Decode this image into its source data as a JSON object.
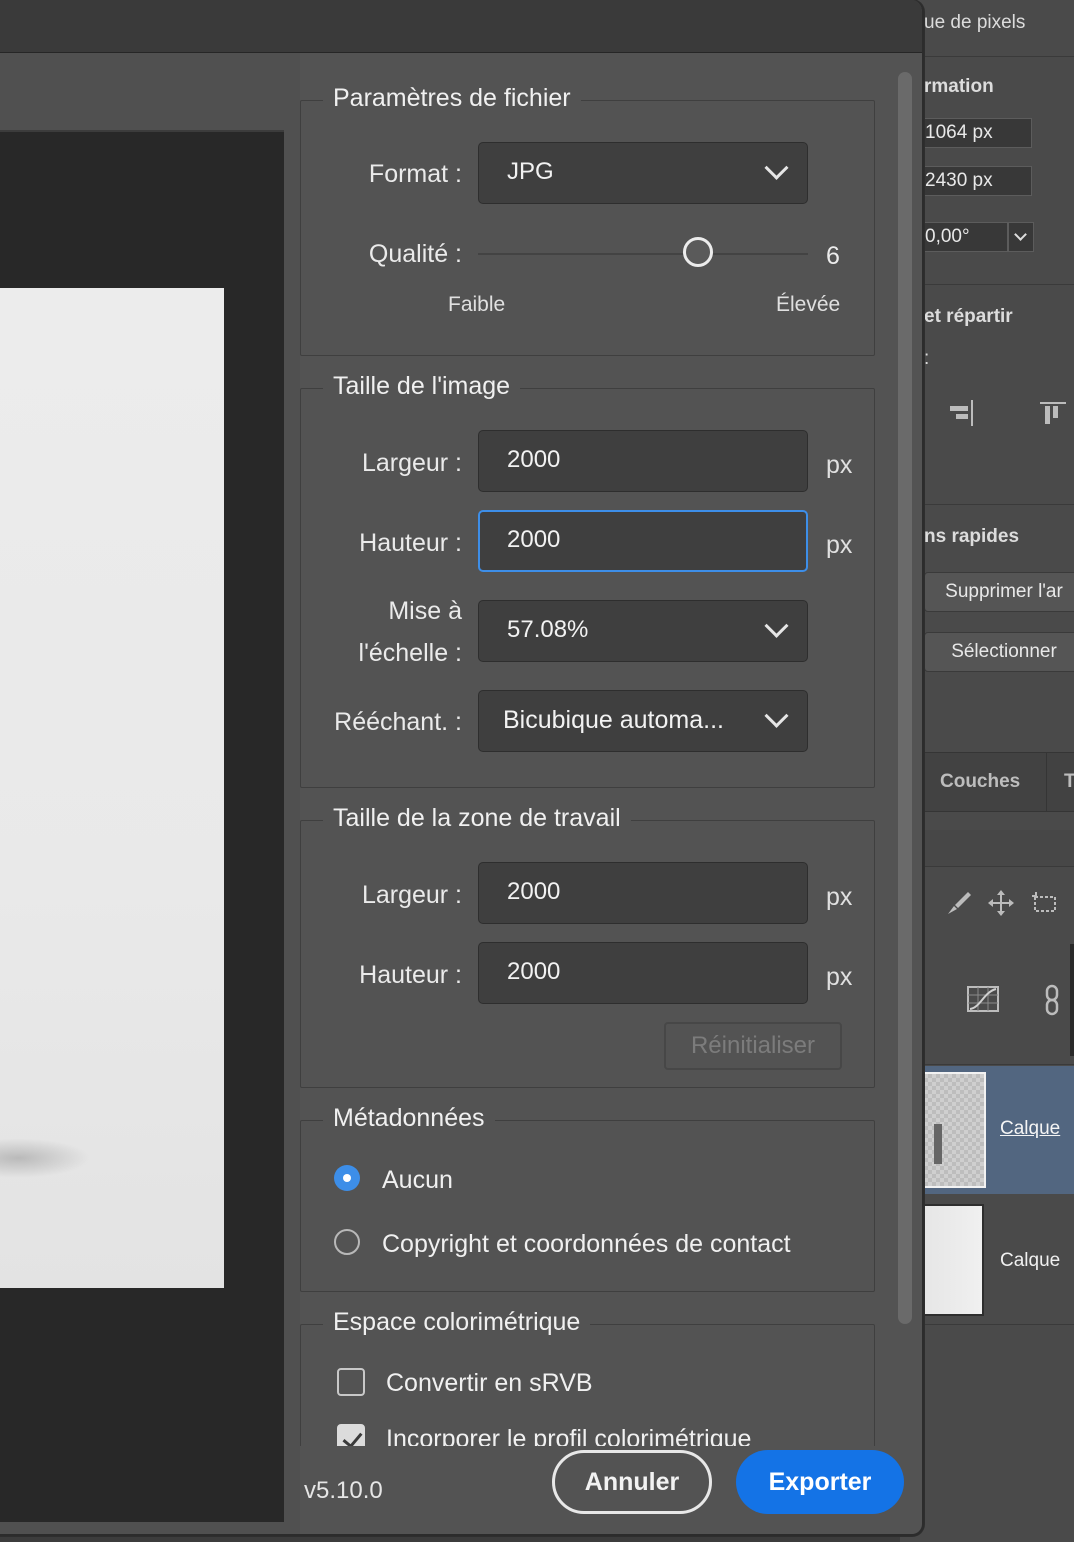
{
  "background_panel": {
    "header": "ue de pixels",
    "section_transform": "rmation",
    "width_value": "1064 px",
    "height_value": "2430 px",
    "angle_value": "0,00°",
    "section_align": "et répartir",
    "align_sub": ":",
    "section_quick": "ns rapides",
    "btn_remove": "Supprimer l'ar",
    "btn_select": "Sélectionner",
    "tab_couches": "Couches",
    "tab_t": "T",
    "layer1_name": "Calque",
    "layer2_name": "Calque"
  },
  "dialog": {
    "file_settings": {
      "legend": "Paramètres de fichier",
      "format_label": "Format :",
      "format_value": "JPG",
      "quality_label": "Qualité :",
      "quality_value": "6",
      "quality_level": 0.667,
      "quality_low": "Faible",
      "quality_high": "Élevée"
    },
    "image_size": {
      "legend": "Taille de l'image",
      "width_label": "Largeur :",
      "width_value": "2000",
      "height_label": "Hauteur :",
      "height_value": "2000",
      "unit": "px",
      "scale_label_1": "Mise à",
      "scale_label_2": "l'échelle :",
      "scale_value": "57.08%",
      "resample_label": "Rééchant. :",
      "resample_value": "Bicubique automa..."
    },
    "canvas_size": {
      "legend": "Taille de la zone de travail",
      "width_label": "Largeur :",
      "width_value": "2000",
      "height_label": "Hauteur :",
      "height_value": "2000",
      "unit": "px",
      "reset_label": "Réinitialiser"
    },
    "metadata": {
      "legend": "Métadonnées",
      "option_none": "Aucun",
      "option_copyright": "Copyright et coordonnées de contact",
      "selected": "Aucun"
    },
    "color_space": {
      "legend": "Espace colorimétrique",
      "convert_srgb": "Convertir en sRVB",
      "convert_checked": false,
      "embed_profile": "Incorporer le profil colorimétrique",
      "embed_checked": true
    },
    "footer": {
      "version": "v5.10.0",
      "cancel_label": "Annuler",
      "export_label": "Exporter"
    },
    "colors": {
      "accent": "#1473e6",
      "focus": "#3d8ee8",
      "dialog_bg": "#535353"
    }
  }
}
